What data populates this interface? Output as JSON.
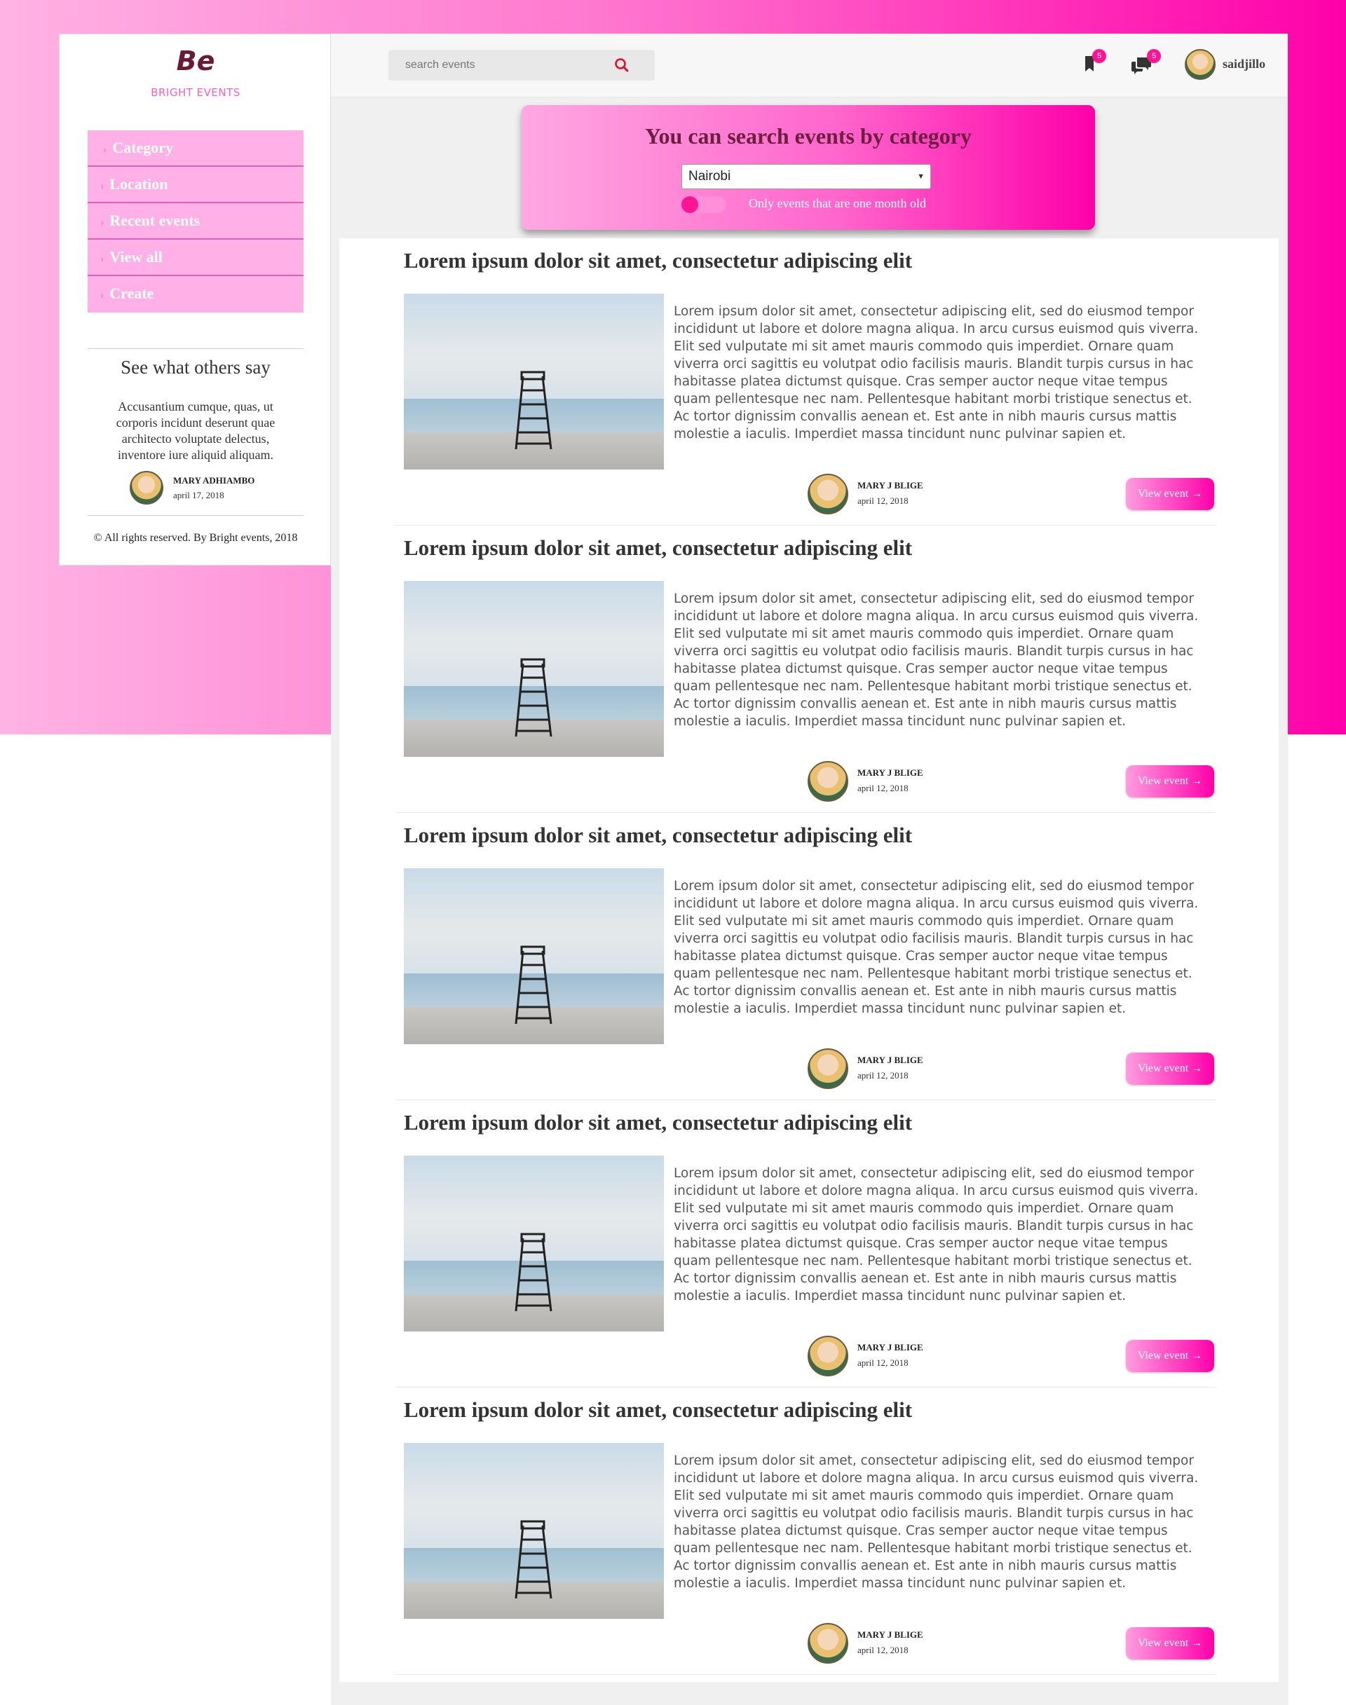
{
  "brand": {
    "logo": "Be",
    "name": "BRIGHT EVENTS"
  },
  "sidebar": {
    "nav": [
      {
        "label": "Category",
        "icon": "chevron-right-icon"
      },
      {
        "label": "Location",
        "icon": "chevron-right-icon"
      },
      {
        "label": "Recent events",
        "icon": "chevron-right-icon"
      },
      {
        "label": "View all",
        "icon": "chevron-right-icon"
      },
      {
        "label": "Create",
        "icon": "chevron-right-icon"
      }
    ],
    "testimonial": {
      "title": "See what others say",
      "text": "Accusantium cumque, quas, ut corporis incidunt deserunt quae architecto voluptate delectus, inventore iure aliquid aliquam.",
      "author": "MARY ADHIAMBO",
      "date": "april 17, 2018"
    },
    "footer": "© All rights reserved. By Bright events, 2018"
  },
  "topbar": {
    "search_placeholder": "search events",
    "bookmark_count": "5",
    "messages_count": "5",
    "username": "saidjillo"
  },
  "filter": {
    "title": "You can search events by category",
    "selected_location": "Nairobi",
    "toggle_label": "Only events that are one month old"
  },
  "events": [
    {
      "title": "Lorem ipsum dolor sit amet, consectetur adipiscing elit",
      "description": "Lorem ipsum dolor sit amet, consectetur adipiscing elit, sed do eiusmod tempor incididunt ut labore et dolore magna aliqua. In arcu cursus euismod quis viverra. Elit sed vulputate mi sit amet mauris commodo quis imperdiet. Ornare quam viverra orci sagittis eu volutpat odio facilisis mauris. Blandit turpis cursus in hac habitasse platea dictumst quisque. Cras semper auctor neque vitae tempus quam pellentesque nec nam. Pellentesque habitant morbi tristique senectus et. Ac tortor dignissim convallis aenean et. Est ante in nibh mauris cursus mattis molestie a iaculis. Imperdiet massa tincidunt nunc pulvinar sapien et.",
      "author": "MARY J BLIGE",
      "date": "april 12, 2018",
      "button": "View event →"
    },
    {
      "title": "Lorem ipsum dolor sit amet, consectetur adipiscing elit",
      "description": "Lorem ipsum dolor sit amet, consectetur adipiscing elit, sed do eiusmod tempor incididunt ut labore et dolore magna aliqua. In arcu cursus euismod quis viverra. Elit sed vulputate mi sit amet mauris commodo quis imperdiet. Ornare quam viverra orci sagittis eu volutpat odio facilisis mauris. Blandit turpis cursus in hac habitasse platea dictumst quisque. Cras semper auctor neque vitae tempus quam pellentesque nec nam. Pellentesque habitant morbi tristique senectus et. Ac tortor dignissim convallis aenean et. Est ante in nibh mauris cursus mattis molestie a iaculis. Imperdiet massa tincidunt nunc pulvinar sapien et.",
      "author": "MARY J BLIGE",
      "date": "april 12, 2018",
      "button": "View event →"
    },
    {
      "title": "Lorem ipsum dolor sit amet, consectetur adipiscing elit",
      "description": "Lorem ipsum dolor sit amet, consectetur adipiscing elit, sed do eiusmod tempor incididunt ut labore et dolore magna aliqua. In arcu cursus euismod quis viverra. Elit sed vulputate mi sit amet mauris commodo quis imperdiet. Ornare quam viverra orci sagittis eu volutpat odio facilisis mauris. Blandit turpis cursus in hac habitasse platea dictumst quisque. Cras semper auctor neque vitae tempus quam pellentesque nec nam. Pellentesque habitant morbi tristique senectus et. Ac tortor dignissim convallis aenean et. Est ante in nibh mauris cursus mattis molestie a iaculis. Imperdiet massa tincidunt nunc pulvinar sapien et.",
      "author": "MARY J BLIGE",
      "date": "april 12, 2018",
      "button": "View event →"
    },
    {
      "title": "Lorem ipsum dolor sit amet, consectetur adipiscing elit",
      "description": "Lorem ipsum dolor sit amet, consectetur adipiscing elit, sed do eiusmod tempor incididunt ut labore et dolore magna aliqua. In arcu cursus euismod quis viverra. Elit sed vulputate mi sit amet mauris commodo quis imperdiet. Ornare quam viverra orci sagittis eu volutpat odio facilisis mauris. Blandit turpis cursus in hac habitasse platea dictumst quisque. Cras semper auctor neque vitae tempus quam pellentesque nec nam. Pellentesque habitant morbi tristique senectus et. Ac tortor dignissim convallis aenean et. Est ante in nibh mauris cursus mattis molestie a iaculis. Imperdiet massa tincidunt nunc pulvinar sapien et.",
      "author": "MARY J BLIGE",
      "date": "april 12, 2018",
      "button": "View event →"
    },
    {
      "title": "Lorem ipsum dolor sit amet, consectetur adipiscing elit",
      "description": "Lorem ipsum dolor sit amet, consectetur adipiscing elit, sed do eiusmod tempor incididunt ut labore et dolore magna aliqua. In arcu cursus euismod quis viverra. Elit sed vulputate mi sit amet mauris commodo quis imperdiet. Ornare quam viverra orci sagittis eu volutpat odio facilisis mauris. Blandit turpis cursus in hac habitasse platea dictumst quisque. Cras semper auctor neque vitae tempus quam pellentesque nec nam. Pellentesque habitant morbi tristique senectus et. Ac tortor dignissim convallis aenean et. Est ante in nibh mauris cursus mattis molestie a iaculis. Imperdiet massa tincidunt nunc pulvinar sapien et.",
      "author": "MARY J BLIGE",
      "date": "april 12, 2018",
      "button": "View event →"
    }
  ],
  "colors": {
    "accent": "#ff00aa",
    "accent_light": "#ffb0e6",
    "title_dark": "#6b2040"
  }
}
